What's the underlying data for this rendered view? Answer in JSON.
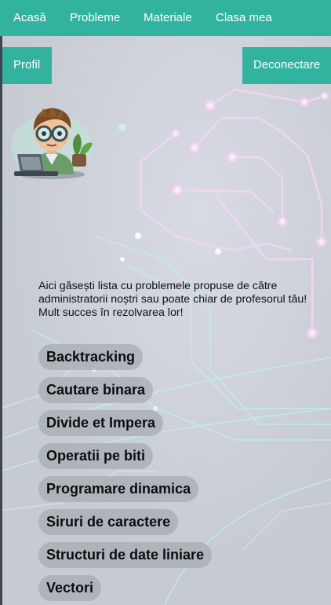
{
  "nav": {
    "home": "Acasă",
    "problems": "Probleme",
    "materials": "Materiale",
    "my_class": "Clasa mea"
  },
  "profile_label": "Profil",
  "logout_label": "Deconectare",
  "intro": {
    "line1": "Aici găsești lista cu problemele propuse de către administratorii noștri sau poate chiar de profesorul tău!",
    "line2": "Mult succes în rezolvarea lor!"
  },
  "categories": [
    "Backtracking",
    "Cautare binara",
    "Divide et Impera",
    "Operatii pe biti",
    "Programare dinamica",
    "Siruri de caractere",
    "Structuri de date liniare",
    "Vectori"
  ],
  "colors": {
    "accent": "#32b3a0",
    "background": "#c9ccd3",
    "pill": "#aaaeb6"
  },
  "icons": {
    "avatar": "programmer-avatar"
  }
}
